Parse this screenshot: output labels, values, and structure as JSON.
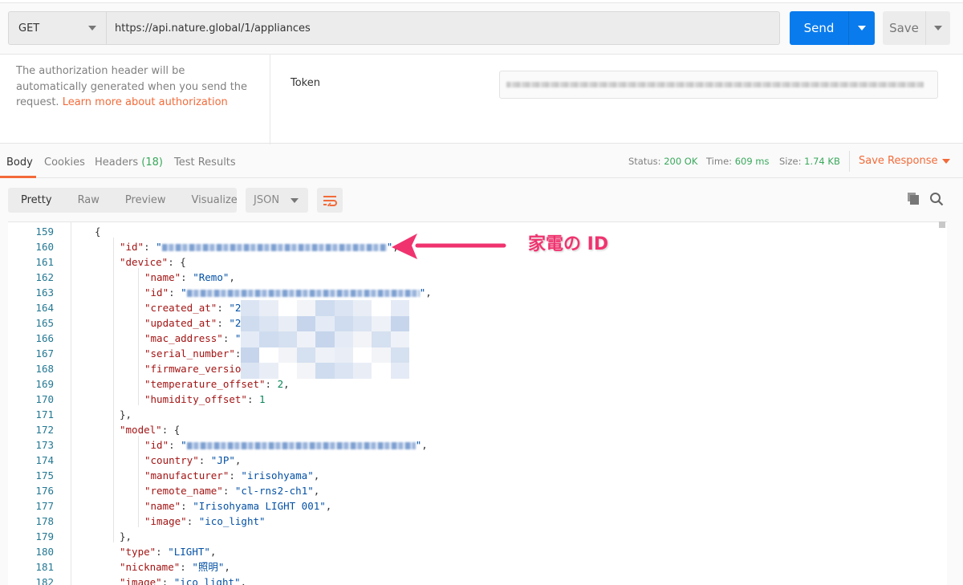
{
  "request": {
    "method": "GET",
    "url": "https://api.nature.global/1/appliances",
    "send_label": "Send",
    "save_label": "Save"
  },
  "auth": {
    "description": "The authorization header will be automatically generated when you send the request.",
    "link": "Learn more about authorization",
    "token_label": "Token"
  },
  "response": {
    "tabs": [
      {
        "label": "Body"
      },
      {
        "label": "Cookies"
      },
      {
        "label": "Headers",
        "count": "(18)"
      },
      {
        "label": "Test Results"
      }
    ],
    "status_label": "Status:",
    "status": "200 OK",
    "time_label": "Time:",
    "time": "609 ms",
    "size_label": "Size:",
    "size": "1.74 KB",
    "save_response": "Save Response",
    "formats": [
      "Pretty",
      "Raw",
      "Preview",
      "Visualize"
    ],
    "language": "JSON"
  },
  "annotation": {
    "text": "家電の ID",
    "color": "#f0336f"
  },
  "colors": {
    "accent": "#f26b3a",
    "send": "#097bed",
    "success": "#3aa85c"
  },
  "code": [
    {
      "n": "159",
      "i": 0,
      "parts": [
        [
          "p",
          "{"
        ]
      ]
    },
    {
      "n": "160",
      "i": 1,
      "parts": [
        [
          "k",
          "\"id\""
        ],
        [
          "p",
          ": "
        ],
        [
          "s",
          "\""
        ],
        [
          "blur",
          ""
        ],
        [
          "s",
          "\""
        ],
        [
          "p",
          ","
        ]
      ]
    },
    {
      "n": "161",
      "i": 1,
      "parts": [
        [
          "k",
          "\"device\""
        ],
        [
          "p",
          ": {"
        ]
      ]
    },
    {
      "n": "162",
      "i": 2,
      "parts": [
        [
          "k",
          "\"name\""
        ],
        [
          "p",
          ": "
        ],
        [
          "s",
          "\"Remo\""
        ],
        [
          "p",
          ","
        ]
      ]
    },
    {
      "n": "163",
      "i": 2,
      "parts": [
        [
          "k",
          "\"id\""
        ],
        [
          "p",
          ": "
        ],
        [
          "s",
          "\""
        ],
        [
          "blur",
          ""
        ],
        [
          "s",
          "\""
        ],
        [
          "p",
          ","
        ]
      ]
    },
    {
      "n": "164",
      "i": 2,
      "parts": [
        [
          "k",
          "\"created_at\""
        ],
        [
          "p",
          ": "
        ],
        [
          "s",
          "\"2"
        ]
      ]
    },
    {
      "n": "165",
      "i": 2,
      "parts": [
        [
          "k",
          "\"updated_at\""
        ],
        [
          "p",
          ": "
        ],
        [
          "s",
          "\"2"
        ]
      ]
    },
    {
      "n": "166",
      "i": 2,
      "parts": [
        [
          "k",
          "\"mac_address\""
        ],
        [
          "p",
          ": "
        ],
        [
          "s",
          "\""
        ]
      ]
    },
    {
      "n": "167",
      "i": 2,
      "parts": [
        [
          "k",
          "\"serial_number\""
        ],
        [
          "p",
          ":"
        ]
      ]
    },
    {
      "n": "168",
      "i": 2,
      "parts": [
        [
          "k",
          "\"firmware_versio"
        ]
      ]
    },
    {
      "n": "169",
      "i": 2,
      "parts": [
        [
          "k",
          "\"temperature_offset\""
        ],
        [
          "p",
          ": "
        ],
        [
          "n",
          "2"
        ],
        [
          "p",
          ","
        ]
      ]
    },
    {
      "n": "170",
      "i": 2,
      "parts": [
        [
          "k",
          "\"humidity_offset\""
        ],
        [
          "p",
          ": "
        ],
        [
          "n",
          "1"
        ]
      ]
    },
    {
      "n": "171",
      "i": 1,
      "parts": [
        [
          "p",
          "},"
        ]
      ]
    },
    {
      "n": "172",
      "i": 1,
      "parts": [
        [
          "k",
          "\"model\""
        ],
        [
          "p",
          ": {"
        ]
      ]
    },
    {
      "n": "173",
      "i": 2,
      "parts": [
        [
          "k",
          "\"id\""
        ],
        [
          "p",
          ": "
        ],
        [
          "s",
          "\""
        ],
        [
          "blur",
          ""
        ],
        [
          "s",
          "\""
        ],
        [
          "p",
          ","
        ]
      ]
    },
    {
      "n": "174",
      "i": 2,
      "parts": [
        [
          "k",
          "\"country\""
        ],
        [
          "p",
          ": "
        ],
        [
          "s",
          "\"JP\""
        ],
        [
          "p",
          ","
        ]
      ]
    },
    {
      "n": "175",
      "i": 2,
      "parts": [
        [
          "k",
          "\"manufacturer\""
        ],
        [
          "p",
          ": "
        ],
        [
          "s",
          "\"irisohyama\""
        ],
        [
          "p",
          ","
        ]
      ]
    },
    {
      "n": "176",
      "i": 2,
      "parts": [
        [
          "k",
          "\"remote_name\""
        ],
        [
          "p",
          ": "
        ],
        [
          "s",
          "\"cl-rns2-ch1\""
        ],
        [
          "p",
          ","
        ]
      ]
    },
    {
      "n": "177",
      "i": 2,
      "parts": [
        [
          "k",
          "\"name\""
        ],
        [
          "p",
          ": "
        ],
        [
          "s",
          "\"Irisohyama LIGHT 001\""
        ],
        [
          "p",
          ","
        ]
      ]
    },
    {
      "n": "178",
      "i": 2,
      "parts": [
        [
          "k",
          "\"image\""
        ],
        [
          "p",
          ": "
        ],
        [
          "s",
          "\"ico_light\""
        ]
      ]
    },
    {
      "n": "179",
      "i": 1,
      "parts": [
        [
          "p",
          "},"
        ]
      ]
    },
    {
      "n": "180",
      "i": 1,
      "parts": [
        [
          "k",
          "\"type\""
        ],
        [
          "p",
          ": "
        ],
        [
          "s",
          "\"LIGHT\""
        ],
        [
          "p",
          ","
        ]
      ]
    },
    {
      "n": "181",
      "i": 1,
      "parts": [
        [
          "k",
          "\"nickname\""
        ],
        [
          "p",
          ": "
        ],
        [
          "s",
          "\"照明\""
        ],
        [
          "p",
          ","
        ]
      ]
    },
    {
      "n": "182",
      "i": 1,
      "parts": [
        [
          "k",
          "\"image\""
        ],
        [
          "p",
          ": "
        ],
        [
          "s",
          "\"ico_light\""
        ],
        [
          "p",
          ","
        ]
      ]
    }
  ]
}
